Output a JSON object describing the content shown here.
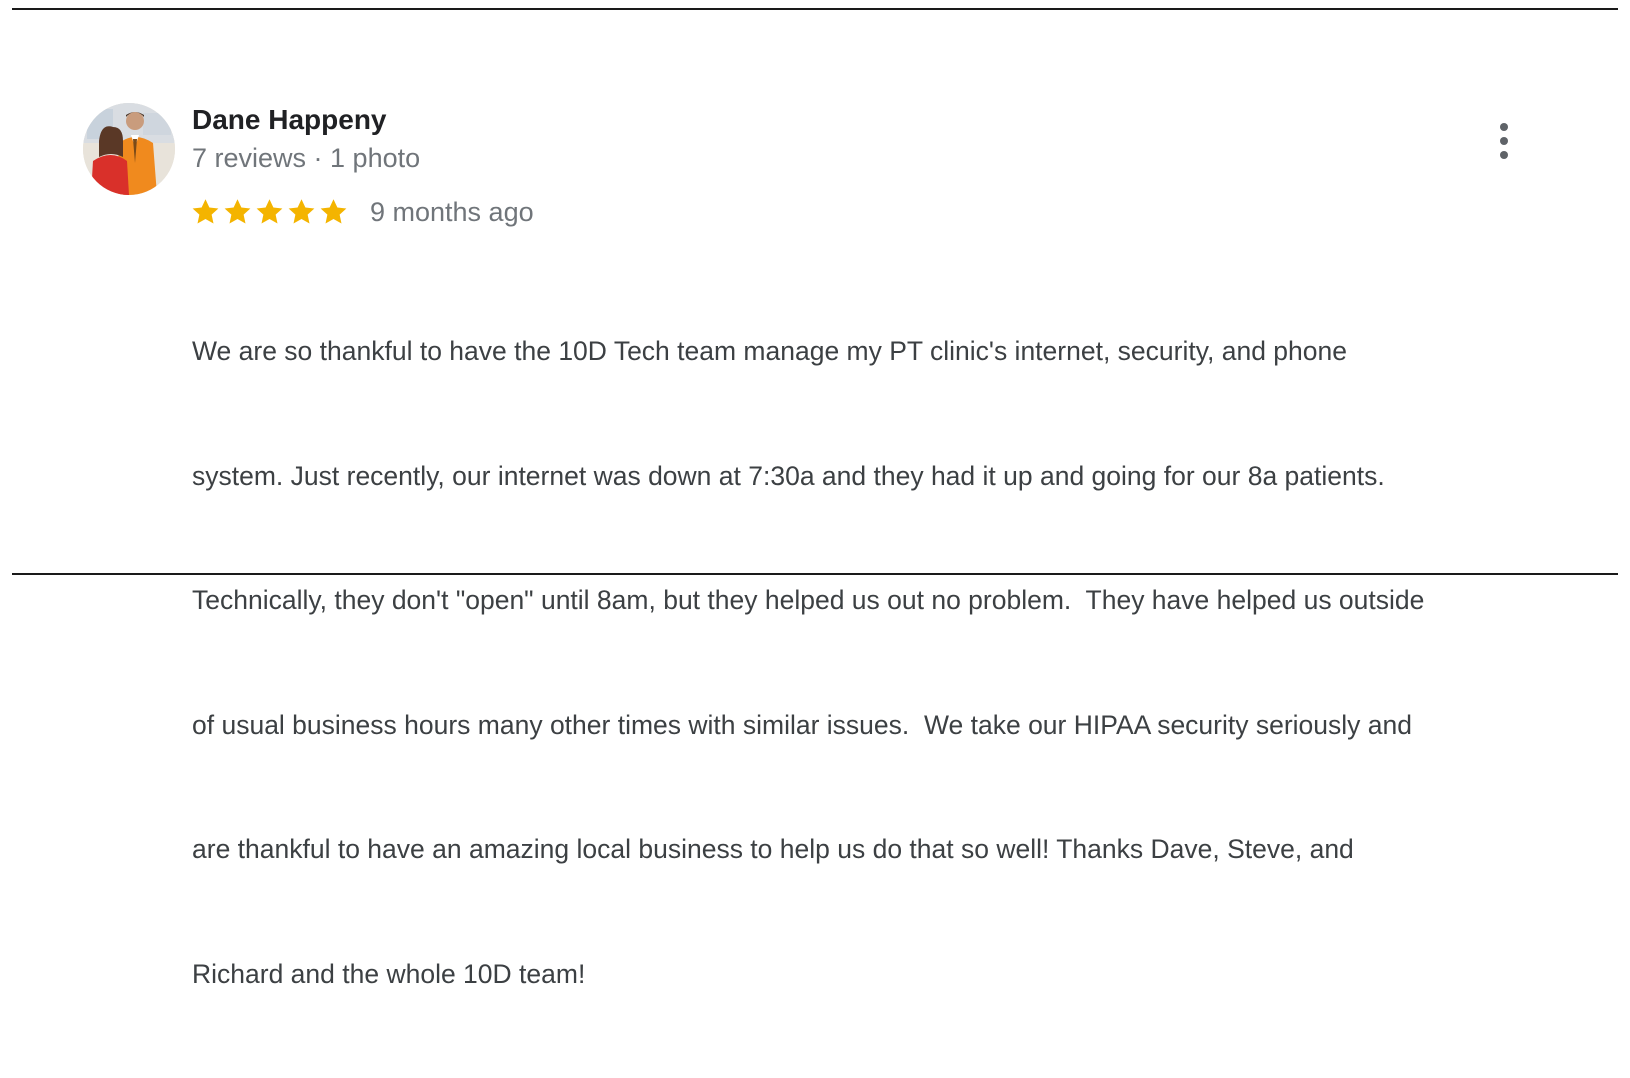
{
  "review": {
    "author_name": "Dane Happeny",
    "author_meta": "7 reviews · 1 photo",
    "rating": 5,
    "rating_max": 5,
    "time_ago": "9 months ago",
    "text_lines": [
      "We are so thankful to have the 10D Tech team manage my PT clinic's internet, security, and phone",
      "system. Just recently, our internet was down at 7:30a and they had it up and going for our 8a patients.",
      "Technically, they don't \"open\" until 8am, but they helped us out no problem.  They have helped us outside",
      "of usual business hours many other times with similar issues.  We take our HIPAA security seriously and",
      "are thankful to have an amazing local business to help us do that so well! Thanks Dave, Steve, and",
      "Richard and the whole 10D team!"
    ]
  },
  "icons": {
    "star": "star-icon",
    "more": "more-vert-icon"
  },
  "colors": {
    "star_fill": "#f4b400",
    "name": "#202124",
    "meta": "#70757a",
    "body": "#3c4043",
    "rule": "#1a1a1a"
  }
}
